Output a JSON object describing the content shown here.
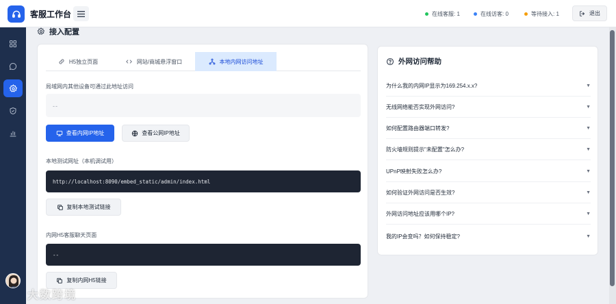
{
  "header": {
    "app_title": "客服工作台",
    "stats": [
      {
        "label": "在线客服: 1",
        "color": "#22c55e"
      },
      {
        "label": "在线访客: 0",
        "color": "#3b82f6"
      },
      {
        "label": "等待接入: 1",
        "color": "#f59e0b"
      }
    ],
    "logout_label": "退出"
  },
  "sidebar": {
    "items": [
      {
        "icon": "dashboard-icon"
      },
      {
        "icon": "chat-icon"
      },
      {
        "icon": "gear-icon",
        "active": true
      },
      {
        "icon": "shield-icon"
      },
      {
        "icon": "bar-chart-icon"
      }
    ]
  },
  "page": {
    "title": "接入配置"
  },
  "tabs": [
    {
      "label": "H5独立页面",
      "icon": "link-icon"
    },
    {
      "label": "网站/商城悬浮窗口",
      "icon": "code-icon"
    },
    {
      "label": "本地内网访问地址",
      "icon": "network-icon",
      "active": true
    }
  ],
  "main": {
    "lan_label": "局域网内其他设备可通过此地址访问",
    "lan_value": "--",
    "view_lan_ip": "查看内网IP地址",
    "view_public_ip": "查看公网IP地址",
    "local_test_label": "本地测试网址（本机调试用）",
    "local_test_url": "http://localhost:8090/embed_static/admin/index.html",
    "copy_local": "复制本地测试链接",
    "lan_h5_label": "内网H5客服聊天页面",
    "lan_h5_value": "--",
    "copy_lan_h5": "复制内网H5链接"
  },
  "help": {
    "title": "外网访问帮助",
    "items": [
      "为什么我的内网IP显示为169.254.x.x?",
      "无线网络能否实现外网访问?",
      "如何配置路由器端口转发?",
      "防火墙规则提示\"未配置\"怎么办?",
      "UPnP映射失败怎么办?",
      "如何验证外网访问是否生效?",
      "外网访问地址应该用哪个IP?",
      "我的IP会变吗？如何保持稳定?"
    ]
  },
  "watermark": "大数跨境",
  "colors": {
    "accent": "#2563eb",
    "sidebar": "#1e2f4d"
  }
}
